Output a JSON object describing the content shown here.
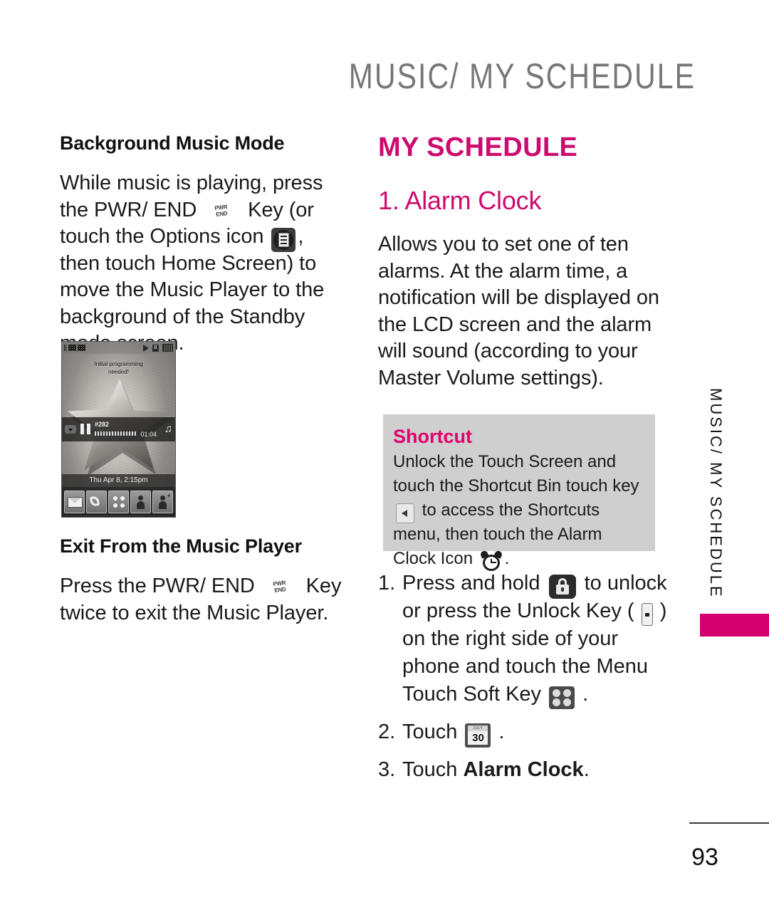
{
  "header": {
    "title": "MUSIC/ MY SCHEDULE"
  },
  "side_tab": {
    "label": "MUSIC/ MY SCHEDULE"
  },
  "footer": {
    "page_number": "93"
  },
  "colors": {
    "magenta": "#CD0A6D",
    "shortcut_magenta": "#E2006C",
    "tab_magenta": "#D4006E",
    "header_gray": "#77777A",
    "shortcut_box_gray": "#CFCFCF"
  },
  "left_column": {
    "section1_heading": "Background Music Mode",
    "section1_text_part1": "While music is playing, press the PWR/ END ",
    "section1_text_part2": " Key (or touch the Options icon ",
    "section1_text_part3": ", then touch Home Screen) to move the Music Player to the background of the Standby mode screen.",
    "section2_heading": "Exit From the Music Player",
    "section2_text_part1": "Press the PWR/ END ",
    "section2_text_part2": " Key twice to exit the Music Player.",
    "pwr_key_label_line1": "PWR",
    "pwr_key_label_line2": "END"
  },
  "phone_screenshot": {
    "notice_line1": "Initial programming",
    "notice_line2": "needed!",
    "player_track": "#282",
    "player_time": "01:04",
    "date_bar": "Thu Apr 8, 2:15pm",
    "bluetooth_glyph": "B",
    "music_note_glyph": "♫",
    "dock_add_glyph": "+"
  },
  "right_column": {
    "title": "MY SCHEDULE",
    "subtitle": "1. Alarm Clock",
    "body": "Allows you to set one of ten alarms. At the alarm time, a notification will be displayed on the LCD screen and the alarm will sound (according to your Master Volume settings)."
  },
  "shortcut": {
    "title": "Shortcut",
    "text_part1": "Unlock the Touch Screen and touch the Shortcut Bin touch key ",
    "text_part2": " to access the Shortcuts menu, then touch the Alarm Clock Icon ",
    "text_part3": "."
  },
  "steps": [
    {
      "number": "1.",
      "part1": "Press and hold ",
      "part2": " to unlock or press the Unlock Key ( ",
      "part3": " ) on the right side of your phone and touch the Menu Touch Soft Key ",
      "part4": " ."
    },
    {
      "number": "2.",
      "part1": "Touch ",
      "part2": " ."
    },
    {
      "number": "3.",
      "part1": "Touch ",
      "bold": "Alarm Clock",
      "part2": "."
    }
  ],
  "calendar_icon": {
    "month_label": "JULY",
    "day": "30"
  }
}
